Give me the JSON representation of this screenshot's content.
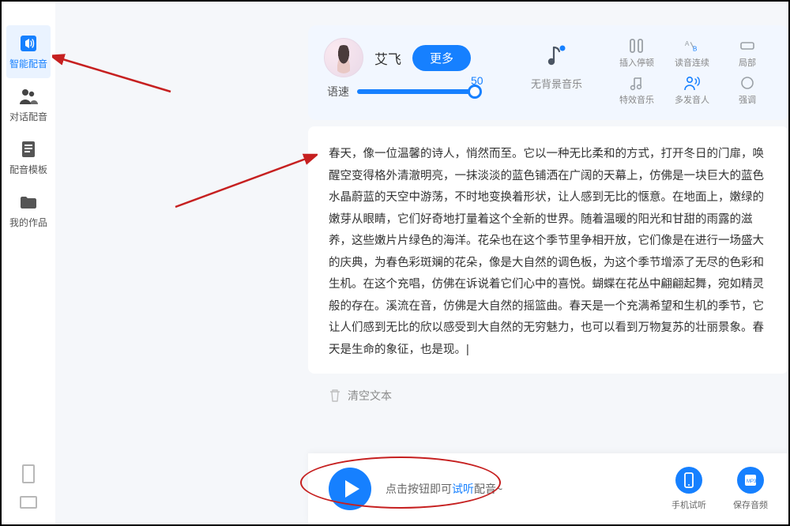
{
  "sidebar": {
    "items": [
      {
        "label": "智能配音"
      },
      {
        "label": "对话配音"
      },
      {
        "label": "配音模板"
      },
      {
        "label": "我的作品"
      }
    ]
  },
  "voice": {
    "name": "艾飞",
    "more_label": "更多",
    "speed_label": "语速",
    "speed_value": "50"
  },
  "music": {
    "label": "无背景音乐"
  },
  "tools": {
    "row1": [
      {
        "label": "插入停顿"
      },
      {
        "label": "读音连续"
      },
      {
        "label": "局部"
      }
    ],
    "row2": [
      {
        "label": "特效音乐"
      },
      {
        "label": "多发音人"
      },
      {
        "label": "强调"
      }
    ]
  },
  "body_text": "春天，像一位温馨的诗人，悄然而至。它以一种无比柔和的方式，打开冬日的门扉，唤醒空变得格外清澈明亮，一抹淡淡的蓝色铺洒在广阔的天幕上，仿佛是一块巨大的蓝色水晶蔚蓝的天空中游荡，不时地变换着形状，让人感到无比的惬意。在地面上，嫩绿的嫩芽从眼睛，它们好奇地打量着这个全新的世界。随着温暖的阳光和甘甜的雨露的滋养，这些嫩片片绿色的海洋。花朵也在这个季节里争相开放，它们像是在进行一场盛大的庆典，为春色彩斑斓的花朵，像是大自然的调色板，为这个季节增添了无尽的色彩和生机。在这个充唱，仿佛在诉说着它们心中的喜悦。蝴蝶在花丛中翩翩起舞，宛如精灵般的存在。溪流在音，仿佛是大自然的摇篮曲。春天是一个充满希望和生机的季节，它让人们感到无比的欣以感受到大自然的无穷魅力，也可以看到万物复苏的壮丽景象。春天是生命的象征，也是现。|",
  "clear_text": "清空文本",
  "footer": {
    "hint_prefix": "点击按钮即可",
    "hint_highlight": "试听",
    "hint_suffix": "配音~",
    "mobile_label": "手机试听",
    "save_label": "保存音频"
  }
}
